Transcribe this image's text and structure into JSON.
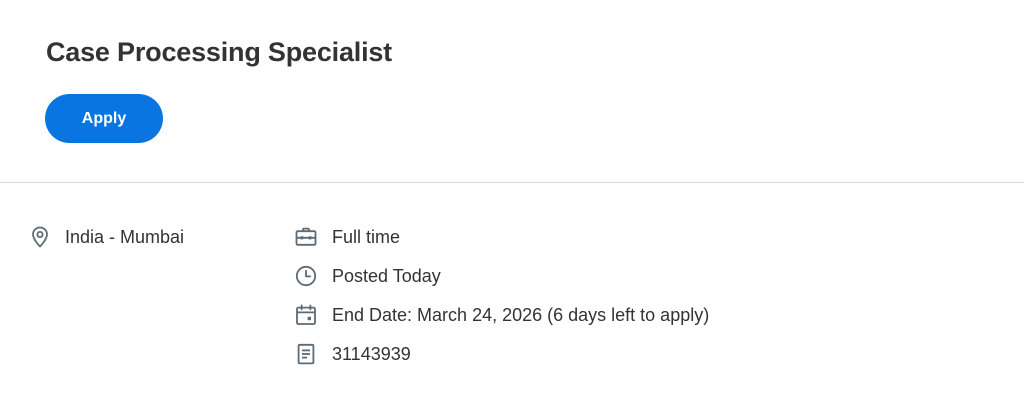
{
  "job": {
    "title": "Case Processing Specialist",
    "apply_label": "Apply"
  },
  "details": {
    "location": {
      "text": "India - Mumbai",
      "icon": "location-pin-icon"
    },
    "work_type": {
      "text": "Full time",
      "icon": "briefcase-icon"
    },
    "posted": {
      "text": "Posted Today",
      "icon": "clock-icon"
    },
    "end_date": {
      "text": "End Date: March 24, 2026 (6 days left to apply)",
      "icon": "calendar-icon"
    },
    "requisition_id": {
      "text": "31143939",
      "icon": "document-icon"
    }
  },
  "colors": {
    "accent": "#0875e1",
    "text": "#333333",
    "icon": "#5e6a75",
    "divider": "#d9d9d9"
  }
}
